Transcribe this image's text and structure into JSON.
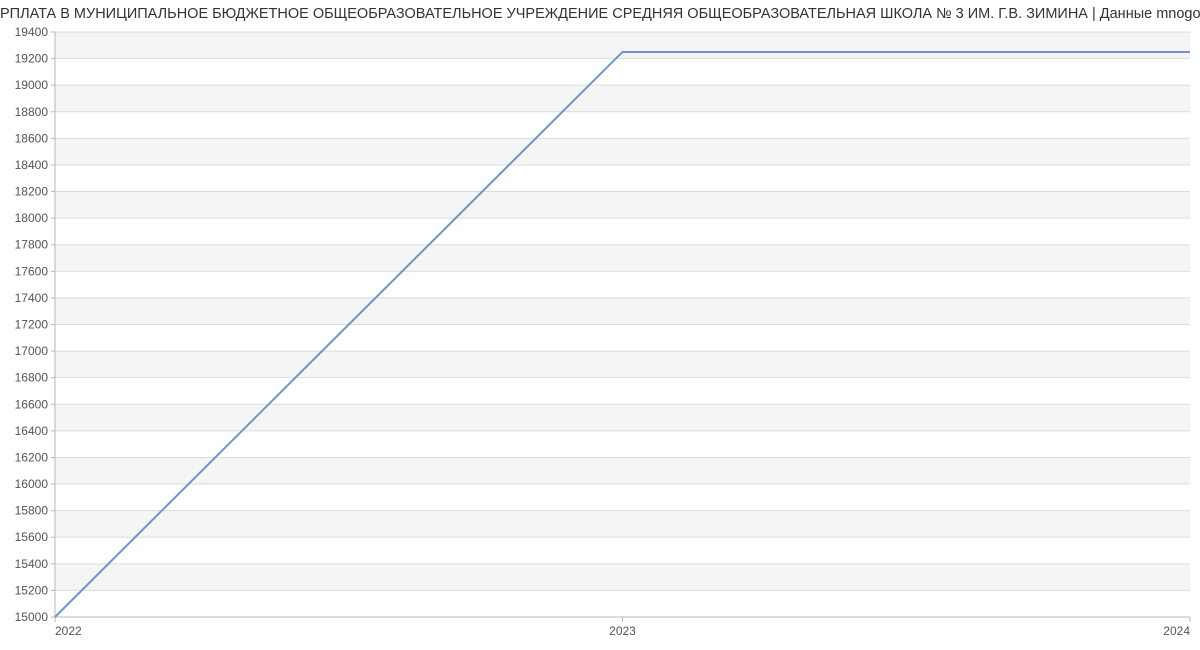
{
  "title": "РПЛАТА В МУНИЦИПАЛЬНОЕ БЮДЖЕТНОЕ ОБЩЕОБРАЗОВАТЕЛЬНОЕ УЧРЕЖДЕНИЕ СРЕДНЯЯ ОБЩЕОБРАЗОВАТЕЛЬНАЯ ШКОЛА № 3 ИМ. Г.В. ЗИМИНА | Данные mnogo.wo",
  "chart_data": {
    "type": "line",
    "x": [
      2022,
      2023,
      2024
    ],
    "values": [
      15000,
      19250,
      19250
    ],
    "xticks": [
      2022,
      2023,
      2024
    ],
    "yticks": [
      15000,
      15200,
      15400,
      15600,
      15800,
      16000,
      16200,
      16400,
      16600,
      16800,
      17000,
      17200,
      17400,
      17600,
      17800,
      18000,
      18200,
      18400,
      18600,
      18800,
      19000,
      19200,
      19400
    ],
    "ylim": [
      15000,
      19400
    ],
    "xlim": [
      2022,
      2024
    ],
    "xlabel": "",
    "ylabel": ""
  }
}
